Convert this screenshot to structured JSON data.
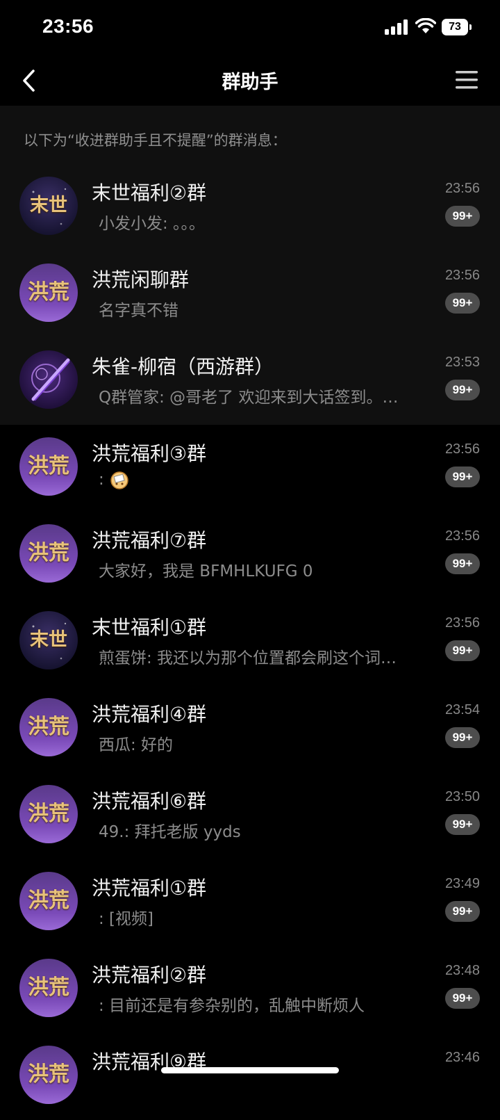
{
  "status": {
    "time": "23:56",
    "battery": "73"
  },
  "nav": {
    "title": "群助手"
  },
  "info_text": "以下为“收进群助手且不提醒”的群消息：",
  "chats": [
    {
      "name": "末世福利②群",
      "msg": "小发小发: 。。。",
      "time": "23:56",
      "badge": "99+",
      "avatar": "末世",
      "avatar_type": "moshi",
      "pinned": true
    },
    {
      "name": "洪荒闲聊群",
      "msg": "名字真不错",
      "time": "23:56",
      "badge": "99+",
      "avatar": "洪荒",
      "avatar_type": "honghuang",
      "pinned": true
    },
    {
      "name": "朱雀-柳宿（西游群）",
      "msg": "Q群管家: @哥老了 欢迎来到大话签到。…",
      "time": "23:53",
      "badge": "99+",
      "avatar": "",
      "avatar_type": "xiyou",
      "pinned": true
    },
    {
      "name": "洪荒福利③群",
      "msg": ":",
      "time": "23:56",
      "badge": "99+",
      "avatar": "洪荒",
      "avatar_type": "honghuang",
      "pinned": false,
      "emoji": true
    },
    {
      "name": "洪荒福利⑦群",
      "msg": "大家好，我是 BFMHLKUFG 0",
      "time": "23:56",
      "badge": "99+",
      "avatar": "洪荒",
      "avatar_type": "honghuang",
      "pinned": false
    },
    {
      "name": "末世福利①群",
      "msg": "煎蛋饼: 我还以为那个位置都会刷这个词…",
      "time": "23:56",
      "badge": "99+",
      "avatar": "末世",
      "avatar_type": "moshi",
      "pinned": false
    },
    {
      "name": "洪荒福利④群",
      "msg": "西瓜: 好的",
      "time": "23:54",
      "badge": "99+",
      "avatar": "洪荒",
      "avatar_type": "honghuang",
      "pinned": false
    },
    {
      "name": "洪荒福利⑥群",
      "msg": "49.: 拜托老版 yyds",
      "time": "23:50",
      "badge": "99+",
      "avatar": "洪荒",
      "avatar_type": "honghuang",
      "pinned": false
    },
    {
      "name": "洪荒福利①群",
      "msg": ": [视频]",
      "time": "23:49",
      "badge": "99+",
      "avatar": "洪荒",
      "avatar_type": "honghuang",
      "pinned": false
    },
    {
      "name": "洪荒福利②群",
      "msg": ": 目前还是有参杂别的，乱触中断烦人",
      "time": "23:48",
      "badge": "99+",
      "avatar": "洪荒",
      "avatar_type": "honghuang",
      "pinned": false
    },
    {
      "name": "洪荒福利⑨群",
      "msg": "",
      "time": "23:46",
      "badge": "",
      "avatar": "洪荒",
      "avatar_type": "honghuang",
      "pinned": false
    }
  ],
  "colors": {
    "background": "#000000",
    "pinned_bg": "#101010",
    "badge_bg": "#4d4d4d",
    "avatar_purple": "#6b3fa0",
    "avatar_gold": "#e8c27a"
  }
}
